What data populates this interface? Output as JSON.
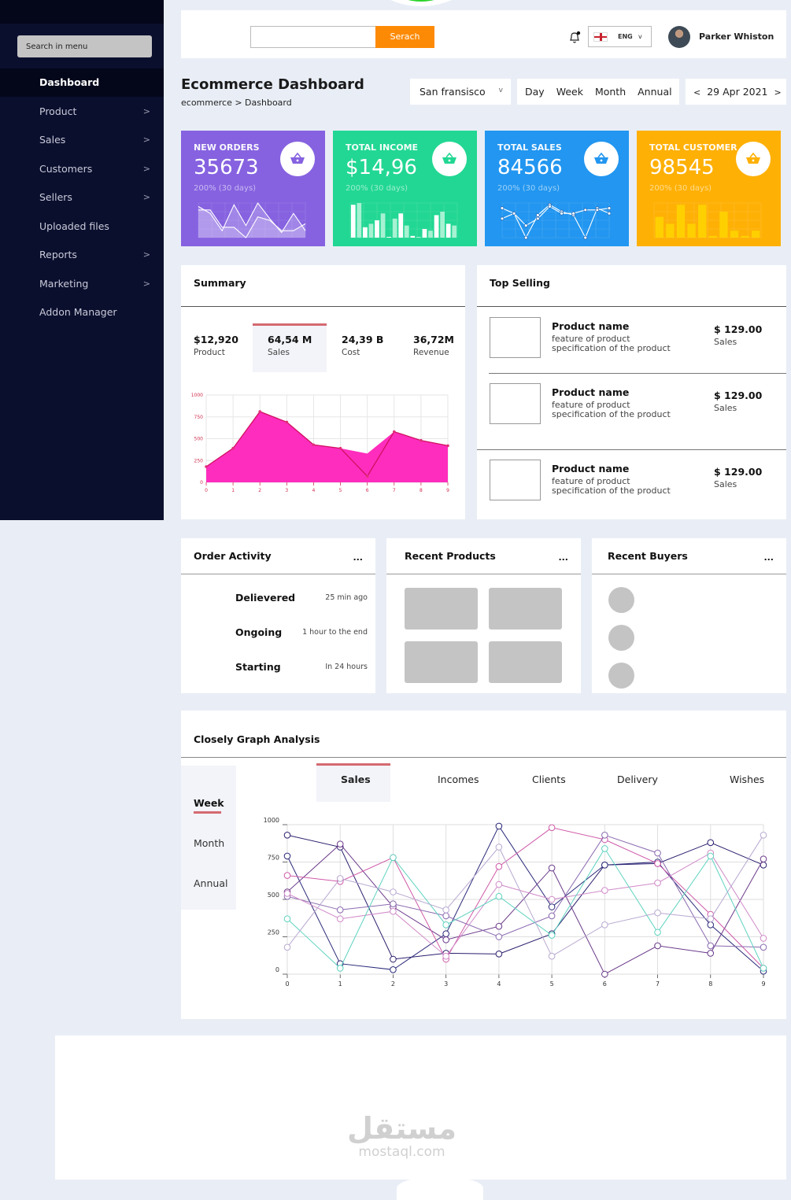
{
  "sidebar": {
    "search_placeholder": "Search in menu",
    "items": [
      {
        "label": "Dashboard",
        "active": true,
        "has_children": false
      },
      {
        "label": "Product",
        "has_children": true
      },
      {
        "label": "Sales",
        "has_children": true
      },
      {
        "label": "Customers",
        "has_children": true
      },
      {
        "label": "Sellers",
        "has_children": true
      },
      {
        "label": "Uploaded files",
        "has_children": false
      },
      {
        "label": "Reports",
        "has_children": true
      },
      {
        "label": "Marketing",
        "has_children": true
      },
      {
        "label": "Addon Manager",
        "has_children": false
      }
    ],
    "chevron": ">"
  },
  "topbar": {
    "search_value": "",
    "search_button": "Serach",
    "language": "ENG",
    "language_caret": "v",
    "user_name": "Parker Whiston"
  },
  "header": {
    "title": "Ecommerce Dashboard",
    "breadcrumb": "ecommerce > Dashboard",
    "city": "San fransisco",
    "city_caret": "v",
    "periods": [
      "Day",
      "Week",
      "Month",
      "Annual"
    ],
    "date": "29 Apr 2021",
    "prev": "<",
    "next": ">"
  },
  "stats": [
    {
      "label": "NEW ORDERS",
      "value": "35673",
      "sub": "200% (30 days)",
      "color": "#8662e0",
      "icon": "basket-icon"
    },
    {
      "label": "TOTAL INCOME",
      "value": "$14,96",
      "sub": "200% (30 days)",
      "color": "#22d793",
      "icon": "basket-icon"
    },
    {
      "label": "TOTAL SALES",
      "value": "84566",
      "sub": "200% (30 days)",
      "color": "#2296f0",
      "icon": "basket-icon"
    },
    {
      "label": "TOTAL CUSTOMER",
      "value": "98545",
      "sub": "200% (30 days)",
      "color": "#ffb005",
      "icon": "basket-icon"
    }
  ],
  "summary": {
    "title": "Summary",
    "items": [
      {
        "value": "$12,920",
        "label": "Product"
      },
      {
        "value": "64,54 M",
        "label": "Sales",
        "active": true
      },
      {
        "value": "24,39 B",
        "label": "Cost"
      },
      {
        "value": "36,72M",
        "label": "Revenue"
      }
    ]
  },
  "top_selling": {
    "title": "Top Selling",
    "items": [
      {
        "name": "Product name",
        "desc1": "feature of product",
        "desc2": "specification of the product",
        "price": "$ 129.00",
        "price_label": "Sales"
      },
      {
        "name": "Product name",
        "desc1": "feature of product",
        "desc2": "specification of the product",
        "price": "$ 129.00",
        "price_label": "Sales"
      },
      {
        "name": "Product name",
        "desc1": "feature of product",
        "desc2": "specification of the product",
        "price": "$ 129.00",
        "price_label": "Sales"
      }
    ]
  },
  "order_activity": {
    "title": "Order Activity",
    "menu": "...",
    "items": [
      {
        "status": "Delievered",
        "time": "25 min ago"
      },
      {
        "status": "Ongoing",
        "time": "1 hour to the end"
      },
      {
        "status": "Starting",
        "time": "In 24 hours"
      }
    ]
  },
  "recent_products": {
    "title": "Recent Products",
    "menu": "..."
  },
  "recent_buyers": {
    "title": "Recent Buyers",
    "menu": "..."
  },
  "closely": {
    "title": "Closely Graph Analysis",
    "tabs": [
      "Sales",
      "Incomes",
      "Clients",
      "Delivery",
      "Wishes"
    ],
    "active_tab": "Sales",
    "periods": [
      "Week",
      "Month",
      "Annual"
    ],
    "active_period": "Week"
  },
  "watermark": {
    "arabic": "مستقل",
    "latin": "mostaql.com"
  },
  "chart_data": [
    {
      "id": "summary-area",
      "type": "area",
      "x": [
        0,
        1,
        2,
        3,
        4,
        5,
        6,
        7,
        8,
        9
      ],
      "series": [
        {
          "name": "Sales",
          "values": [
            180,
            390,
            810,
            690,
            430,
            390,
            70,
            580,
            480,
            420
          ],
          "color": "#ff2dbd",
          "line": "#d01060"
        }
      ],
      "ylim": [
        0,
        1000
      ],
      "yticks": [
        0,
        250,
        500,
        750,
        1000
      ],
      "grid": true,
      "tick_color": "#d03050"
    },
    {
      "id": "closely-lines",
      "type": "line",
      "x": [
        0,
        1,
        2,
        3,
        4,
        5,
        6,
        7,
        8,
        9
      ],
      "ylim": [
        0,
        1000
      ],
      "yticks": [
        0,
        250,
        500,
        750,
        1000
      ],
      "grid": true,
      "series": [
        {
          "name": "s1",
          "color": "#2a1f6e",
          "values": [
            930,
            850,
            100,
            140,
            135,
            270,
            730,
            740,
            880,
            730
          ]
        },
        {
          "name": "s2",
          "color": "#2a2a7a",
          "values": [
            790,
            70,
            30,
            270,
            990,
            450,
            730,
            750,
            330,
            20
          ]
        },
        {
          "name": "s3",
          "color": "#6a3a8a",
          "values": [
            550,
            870,
            450,
            230,
            320,
            710,
            0,
            190,
            140,
            770
          ]
        },
        {
          "name": "s4",
          "color": "#cf5aa8",
          "values": [
            660,
            620,
            780,
            100,
            720,
            980,
            900,
            740,
            400,
            40
          ]
        },
        {
          "name": "s5",
          "color": "#8a6ab0",
          "values": [
            520,
            430,
            470,
            390,
            250,
            390,
            930,
            810,
            190,
            180
          ]
        },
        {
          "name": "s6",
          "color": "#d08ac8",
          "values": [
            540,
            370,
            420,
            120,
            600,
            500,
            560,
            610,
            810,
            240
          ]
        },
        {
          "name": "s7",
          "color": "#5fd3c0",
          "values": [
            370,
            40,
            780,
            330,
            520,
            260,
            840,
            280,
            790,
            40
          ]
        },
        {
          "name": "s8",
          "color": "#b8a8d0",
          "values": [
            180,
            640,
            550,
            430,
            850,
            120,
            330,
            410,
            370,
            930
          ]
        }
      ]
    },
    {
      "id": "new-orders-spark",
      "type": "line",
      "series": [
        {
          "name": "a",
          "values": [
            90,
            70,
            20,
            95,
            35,
            100,
            55,
            15,
            70,
            20
          ]
        },
        {
          "name": "b",
          "values": [
            80,
            80,
            30,
            30,
            0,
            60,
            50,
            20,
            20,
            40
          ]
        }
      ],
      "ylim": [
        0,
        100
      ]
    },
    {
      "id": "total-income-spark",
      "type": "bar",
      "values": [
        95,
        100,
        30,
        40,
        50,
        70,
        0,
        55,
        70,
        35,
        5,
        0,
        25,
        20,
        65,
        75,
        40,
        35
      ],
      "ylim": [
        0,
        100
      ]
    },
    {
      "id": "total-sales-spark",
      "type": "line",
      "series": [
        {
          "name": "a",
          "values": [
            85,
            70,
            0,
            65,
            95,
            75,
            65,
            0,
            85,
            70
          ]
        },
        {
          "name": "b",
          "values": [
            55,
            70,
            35,
            55,
            90,
            70,
            70,
            80,
            80,
            85
          ]
        }
      ],
      "ylim": [
        0,
        100
      ]
    },
    {
      "id": "total-customer-spark",
      "type": "bar",
      "values": [
        60,
        40,
        95,
        40,
        95,
        5,
        75,
        20,
        5,
        20
      ],
      "ylim": [
        0,
        100
      ]
    }
  ]
}
